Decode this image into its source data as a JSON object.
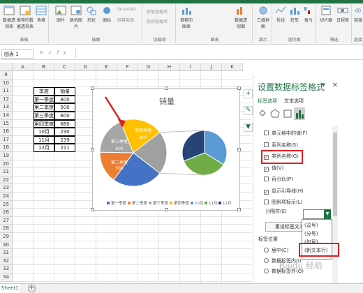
{
  "ribbon": {
    "groups": [
      {
        "name": "表格",
        "buttons": [
          "数据透视表",
          "推荐的数据透视表",
          "表格"
        ]
      },
      {
        "name": "插图",
        "buttons": [
          "图片",
          "联机图片",
          "形状",
          "图标"
        ]
      },
      {
        "name": "加载项",
        "buttons": [
          "获取加载项",
          "我的加载项"
        ]
      },
      {
        "name": "图表",
        "buttons": [
          "推荐的图表",
          "数据透视图"
        ]
      },
      {
        "name": "演示",
        "buttons": [
          "三维地图"
        ]
      },
      {
        "name": "迷你图",
        "buttons": [
          "折线",
          "柱形",
          "盈亏"
        ]
      },
      {
        "name": "筛选",
        "buttons": [
          "切片器",
          "日程表"
        ]
      },
      {
        "name": "链接",
        "buttons": [
          "链接"
        ]
      }
    ],
    "smartart_label": "SmartArt",
    "screenshot_label": "屏幕截图"
  },
  "formula_bar": {
    "name_box": "图表 1",
    "fx_label": "fx"
  },
  "grid": {
    "columns": [
      "A",
      "B",
      "C",
      "D",
      "E",
      "F",
      "G",
      "H",
      "I",
      "J",
      "K"
    ],
    "rows": [
      "9",
      "10",
      "11",
      "12",
      "13",
      "14",
      "15",
      "16",
      "17",
      "18",
      "19",
      "20",
      "21",
      "22",
      "23",
      "24",
      "25",
      "26",
      "27",
      "28",
      "29",
      "30",
      "31",
      "32",
      "33",
      "34"
    ],
    "table_header": [
      "季度",
      "销量"
    ],
    "table_rows": [
      [
        "第一季度",
        "800"
      ],
      [
        "第二季度",
        "500"
      ],
      [
        "第三季度",
        "600"
      ],
      [
        "第四季度",
        "680"
      ],
      [
        "10月",
        "230"
      ],
      [
        "11月",
        "239"
      ],
      [
        "12月",
        "211"
      ]
    ]
  },
  "chart_data": {
    "type": "pie",
    "title": "销量",
    "categories": [
      "第一季度",
      "第二季度",
      "第三季度",
      "第四季度",
      "10月",
      "11月",
      "12月"
    ],
    "values": [
      800,
      500,
      600,
      680,
      230,
      239,
      211
    ],
    "colors": [
      "#4472c4",
      "#ed7d31",
      "#a5a5a5",
      "#ffc000",
      "#5b9bd5",
      "#70ad47",
      "#264478"
    ],
    "legend_placement": "bottom",
    "visible_labels": [
      "第四季度",
      "800",
      "第三季度",
      "600",
      "第二季度",
      "500"
    ]
  },
  "task_pane": {
    "title": "设置数据标签格式",
    "tabs": [
      "标签选项",
      "文本选项"
    ],
    "options": [
      {
        "label": "单元格中的值(F)",
        "checked": false
      },
      {
        "label": "系列名称(S)",
        "checked": false
      },
      {
        "label": "类别名称(G)",
        "checked": true
      },
      {
        "label": "值(V)",
        "checked": true
      },
      {
        "label": "百分比(P)",
        "checked": false
      },
      {
        "label": "显示引导线(H)",
        "checked": true
      },
      {
        "label": "图例项标示(L)",
        "checked": false
      }
    ],
    "separator_label": "分隔符(E)",
    "separator_options": [
      "(逗号)",
      "(分号)",
      "(句号)",
      "(新文本行)"
    ],
    "reset_button": "重设标签文本(R)",
    "position_label": "标签位置",
    "position_options": [
      "居中(C)",
      "数据标签内(I)",
      "数据标签外(O)"
    ]
  },
  "sheet_tab": "Sheet1",
  "watermark": "Baidu 经验",
  "accent_color": "#217346"
}
